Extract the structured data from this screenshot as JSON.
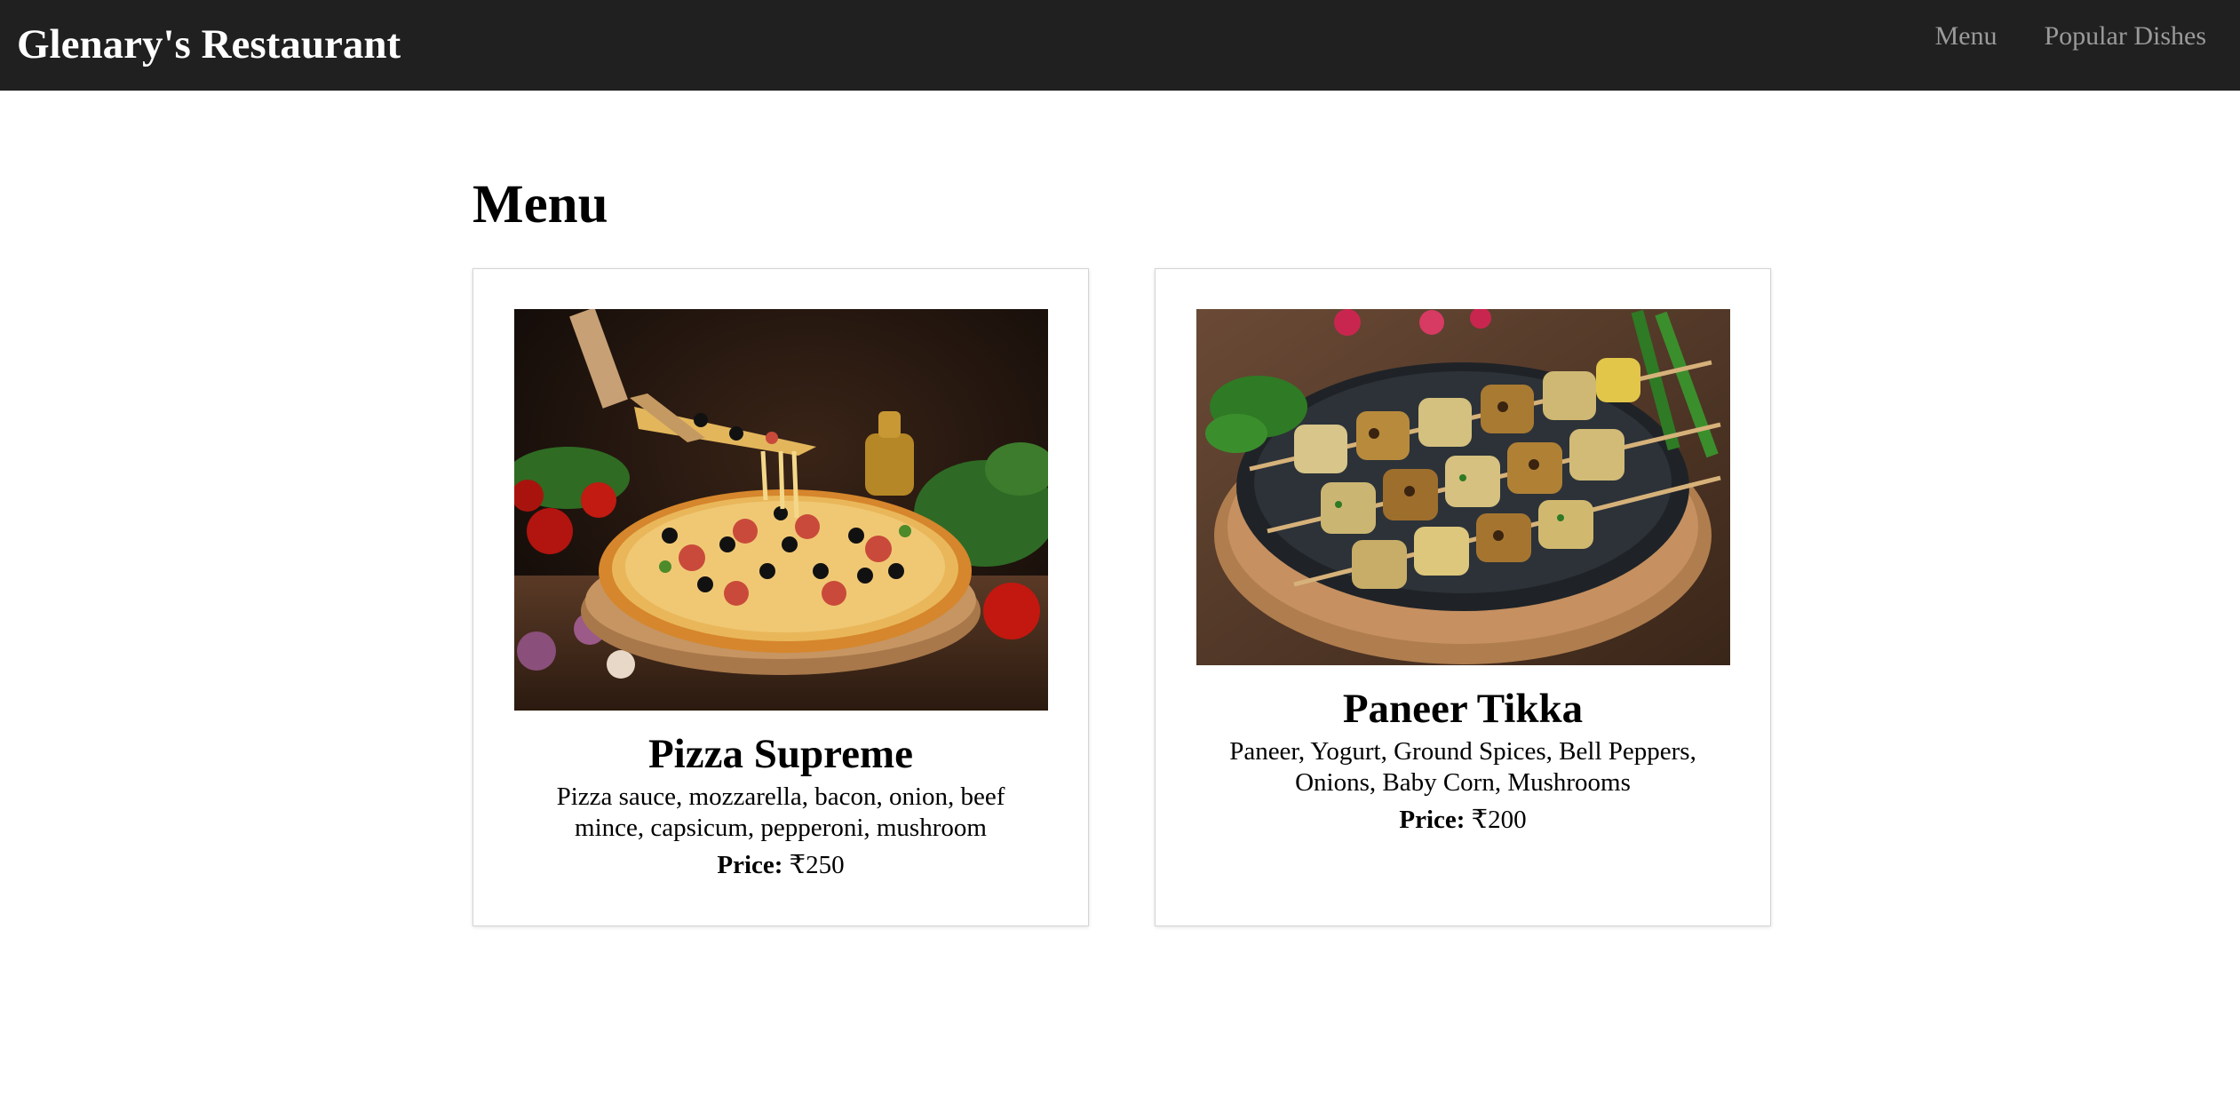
{
  "navbar": {
    "brand": "Glenary's Restaurant",
    "links": [
      {
        "label": "Menu"
      },
      {
        "label": "Popular Dishes"
      }
    ]
  },
  "main": {
    "title": "Menu",
    "dishes": [
      {
        "name": "Pizza Supreme",
        "description": "Pizza sauce, mozzarella, bacon, onion, beef mince, capsicum, pepperoni, mushroom",
        "price_label": "Price:",
        "price": "₹250"
      },
      {
        "name": "Paneer Tikka",
        "description": "Paneer, Yogurt, Ground Spices, Bell Peppers, Onions, Baby Corn, Mushrooms",
        "price_label": "Price:",
        "price": "₹200"
      }
    ]
  },
  "colors": {
    "navbar_bg": "#202020",
    "brand_text": "#ffffff",
    "nav_link_text": "#9a9a9a"
  }
}
